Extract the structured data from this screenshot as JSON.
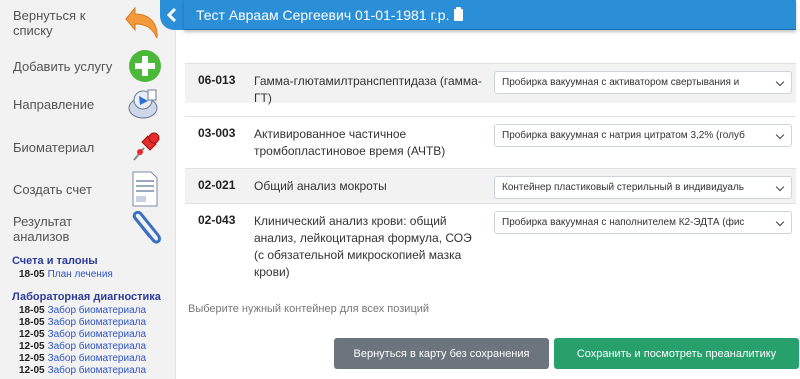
{
  "sidebar": {
    "actions": [
      {
        "label": "Вернуться к списку",
        "icon": "undo-arrow-icon"
      },
      {
        "label": "Добавить услугу",
        "icon": "plus-circle-icon"
      },
      {
        "label": "Направление",
        "icon": "referral-icon"
      },
      {
        "label": "Биоматериал",
        "icon": "pushpin-icon"
      },
      {
        "label": "Создать счет",
        "icon": "invoice-icon"
      },
      {
        "label": "Результат анализов",
        "icon": "paperclip-icon"
      }
    ],
    "sections": [
      {
        "title": "Счета и талоны",
        "entries": [
          {
            "date": "18-05",
            "text": "План лечения"
          }
        ]
      },
      {
        "title": "Лабораторная диагностика",
        "entries": [
          {
            "date": "18-05",
            "text": "Забор биоматериала"
          },
          {
            "date": "18-05",
            "text": "Забор биоматериала"
          },
          {
            "date": "12-05",
            "text": "Забор биоматериала"
          },
          {
            "date": "12-05",
            "text": "Забор биоматериала"
          },
          {
            "date": "12-05",
            "text": "Забор биоматериала"
          },
          {
            "date": "12-05",
            "text": "Забор биоматериала"
          }
        ]
      }
    ]
  },
  "header": {
    "patient": "Тест Авраам Сергеевич 01-01-1981 г.р."
  },
  "services": [
    {
      "code": "06-013",
      "name": "Гамма-глютамилтранспептидаза (гамма-ГТ)",
      "container": "Пробирка вакуумная с активатором свертывания и"
    },
    {
      "code": "03-003",
      "name": "Активированное частичное тромбопластиновое время (АЧТВ)",
      "container": "Пробирка вакуумная с натрия цитратом 3,2% (голуб"
    },
    {
      "code": "02-021",
      "name": "Общий анализ мокроты",
      "container": "Контейнер пластиковый стерильный в индивидуаль"
    },
    {
      "code": "02-043",
      "name": "Клинический анализ крови: общий анализ, лейкоцитарная формула, СОЭ (с обязательной микроскопией мазка крови)",
      "container": "Пробирка вакуумная с наполнителем К2-ЭДТА (фис"
    }
  ],
  "hint": "Выберите нужный контейнер для всех позиций",
  "buttons": {
    "back": "Вернуться в карту без сохранения",
    "save": "Сохранить и посмотреть преаналитику"
  },
  "colors": {
    "header": "#2b8fd8",
    "save": "#28a06b",
    "back": "#6c757d",
    "link": "#2f54c4",
    "section": "#2d3c9c"
  }
}
